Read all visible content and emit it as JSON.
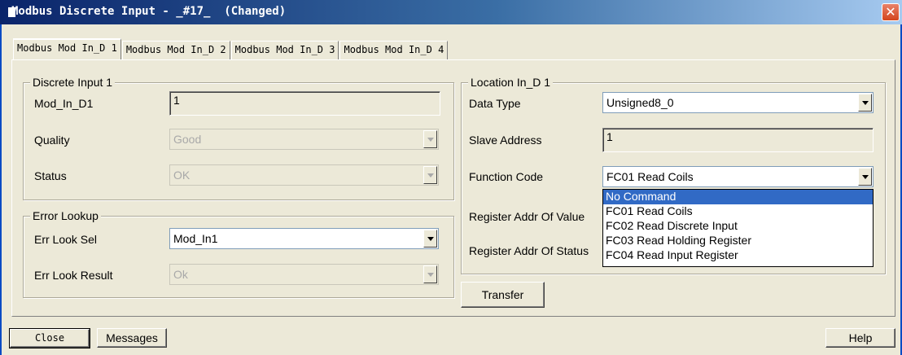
{
  "window": {
    "title": "Modbus Discrete Input - _#17_  (Changed)",
    "close_glyph": "✕"
  },
  "tabs": [
    {
      "label": "Modbus Mod In_D 1",
      "active": true
    },
    {
      "label": "Modbus Mod In_D 2",
      "active": false
    },
    {
      "label": "Modbus Mod In_D 3",
      "active": false
    },
    {
      "label": "Modbus Mod In_D 4",
      "active": false
    }
  ],
  "discrete_input": {
    "group_title": "Discrete Input 1",
    "mod_in_label": "Mod_In_D1",
    "mod_in_value": "1",
    "quality_label": "Quality",
    "quality_value": "Good",
    "status_label": "Status",
    "status_value": "OK"
  },
  "error_lookup": {
    "group_title": "Error Lookup",
    "sel_label": "Err Look Sel",
    "sel_value": "Mod_In1",
    "result_label": "Err Look Result",
    "result_value": "Ok"
  },
  "location": {
    "group_title": "Location In_D 1",
    "data_type_label": "Data Type",
    "data_type_value": "Unsigned8_0",
    "slave_address_label": "Slave Address",
    "slave_address_value": "1",
    "function_code_label": "Function Code",
    "function_code_value": "FC01 Read Coils",
    "register_value_label": "Register Addr Of Value",
    "register_status_label": "Register Addr Of Status",
    "function_code_options": [
      "No Command",
      "FC01 Read Coils",
      "FC02 Read Discrete Input",
      "FC03 Read Holding Register",
      "FC04 Read Input Register"
    ]
  },
  "buttons": {
    "transfer": "Transfer",
    "close": "Close",
    "messages": "Messages",
    "help": "Help"
  },
  "icons": {
    "title_icon": "window-icon",
    "close_icon": "close-icon",
    "dropdown_arrow": "chevron-down-icon"
  },
  "colors": {
    "title_bar": "#0a246a",
    "dialog_bg": "#ece9d8",
    "selection": "#316ac5"
  }
}
